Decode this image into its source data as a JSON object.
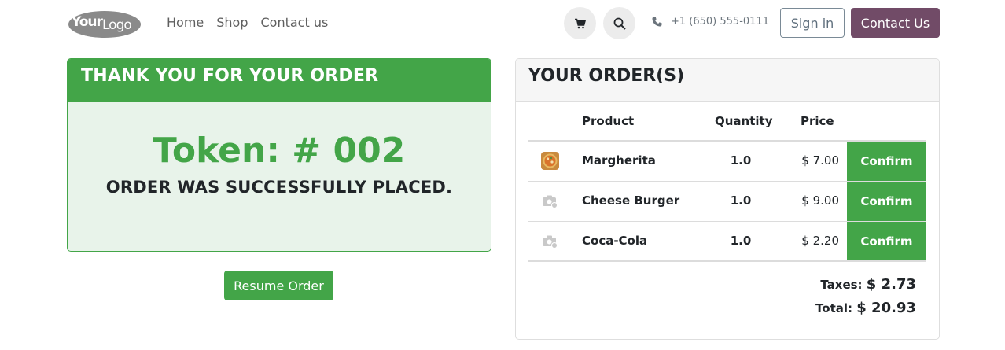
{
  "navbar": {
    "logo_text_1": "Your",
    "logo_text_2": "Logo",
    "links": [
      "Home",
      "Shop",
      "Contact us"
    ],
    "cart_icon": "cart-icon",
    "search_icon": "search-icon",
    "phone_icon": "phone-icon",
    "phone": "+1 (650) 555-0111",
    "signin_label": "Sign in",
    "contact_label": "Contact Us"
  },
  "thank_card": {
    "header": "THANK YOU FOR YOUR ORDER",
    "token": "Token: # 002",
    "message": "ORDER WAS SUCCESSFULLY PLACED."
  },
  "resume_label": "Resume Order",
  "orders": {
    "header": "YOUR ORDER(S)",
    "columns": {
      "product": "Product",
      "quantity": "Quantity",
      "price": "Price"
    },
    "items": [
      {
        "name": "Margherita",
        "quantity": "1.0",
        "price": "$ 7.00",
        "action": "Confirm",
        "image": "pizza-image"
      },
      {
        "name": "Cheese Burger",
        "quantity": "1.0",
        "price": "$ 9.00",
        "action": "Confirm",
        "image": "placeholder-camera-icon"
      },
      {
        "name": "Coca-Cola",
        "quantity": "1.0",
        "price": "$ 2.20",
        "action": "Confirm",
        "image": "placeholder-camera-icon"
      }
    ],
    "taxes_label": "Taxes:",
    "taxes_value": "$ 2.73",
    "total_label": "Total:",
    "total_value": "$ 20.93"
  },
  "colors": {
    "brand_green": "#43a548",
    "brand_purple": "#714b67",
    "light_green_bg": "#e8f3ea"
  }
}
